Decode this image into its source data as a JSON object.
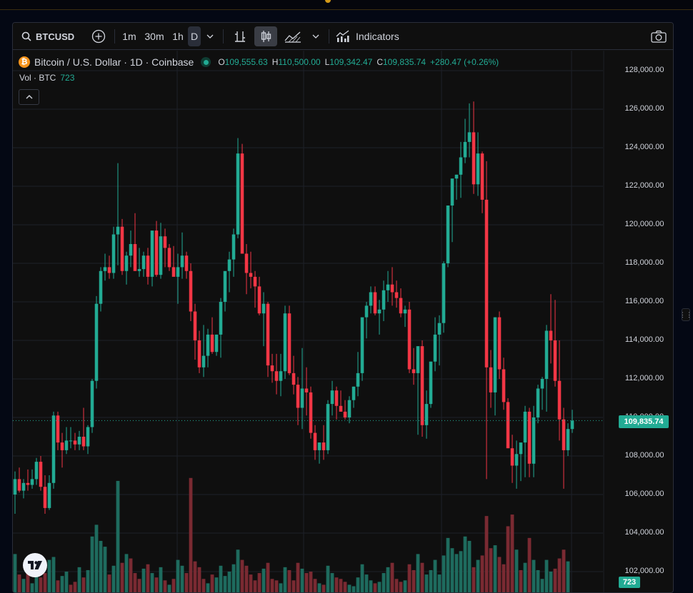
{
  "toolbar": {
    "symbol": "BTCUSD",
    "intervals": [
      "1m",
      "30m",
      "1h",
      "D"
    ],
    "indicators_label": "Indicators"
  },
  "legend": {
    "title": "Bitcoin / U.S. Dollar · 1D · Coinbase",
    "open_label": "O",
    "open": "109,555.63",
    "high_label": "H",
    "high": "110,500.00",
    "low_label": "L",
    "low": "109,342.47",
    "close_label": "C",
    "close": "109,835.74",
    "change": "+280.47 (+0.26%)"
  },
  "volume": {
    "label": "Vol · BTC",
    "value": "723"
  },
  "price_axis": [
    "128,000.00",
    "126,000.00",
    "124,000.00",
    "122,000.00",
    "120,000.00",
    "118,000.00",
    "116,000.00",
    "114,000.00",
    "112,000.00",
    "110,000.00",
    "108,000.00",
    "106,000.00",
    "104,000.00",
    "102,000.00"
  ],
  "last_price_badge": "109,835.74",
  "volume_badge": "723",
  "colors": {
    "up": "#22ab94",
    "down": "#f23645",
    "background": "#0f0f0f"
  },
  "chart_data": {
    "type": "candlestick",
    "ylim": [
      101500,
      129000
    ],
    "last_close": 109835.74,
    "candles": [
      [
        106000,
        107200,
        105000,
        106800
      ],
      [
        106800,
        107400,
        106100,
        106200
      ],
      [
        106200,
        106800,
        105800,
        106600
      ],
      [
        106600,
        107300,
        106200,
        106500
      ],
      [
        106500,
        107300,
        106300,
        106800
      ],
      [
        106800,
        107900,
        106500,
        107700
      ],
      [
        107700,
        108000,
        106200,
        106400
      ],
      [
        106400,
        107000,
        105000,
        105300
      ],
      [
        105300,
        107000,
        105200,
        106600
      ],
      [
        106600,
        110300,
        106300,
        110100
      ],
      [
        110100,
        110300,
        108300,
        108700
      ],
      [
        108700,
        109200,
        107400,
        108300
      ],
      [
        108300,
        109500,
        108100,
        108800
      ],
      [
        108800,
        109500,
        108400,
        108800
      ],
      [
        108800,
        109200,
        108300,
        108600
      ],
      [
        108600,
        109300,
        108300,
        109000
      ],
      [
        109000,
        110500,
        108300,
        108500
      ],
      [
        108500,
        109600,
        108100,
        109500
      ],
      [
        109500,
        112000,
        109200,
        111900
      ],
      [
        111900,
        116300,
        111500,
        115900
      ],
      [
        115900,
        117800,
        115500,
        117600
      ],
      [
        117600,
        118500,
        117100,
        117800
      ],
      [
        117800,
        118400,
        117200,
        117500
      ],
      [
        117500,
        119900,
        117200,
        119500
      ],
      [
        119500,
        123200,
        117900,
        119900
      ],
      [
        119900,
        120300,
        117400,
        117600
      ],
      [
        117600,
        118600,
        116900,
        118400
      ],
      [
        118400,
        119700,
        117800,
        119000
      ],
      [
        119000,
        120600,
        117900,
        117600
      ],
      [
        117600,
        118800,
        117300,
        117700
      ],
      [
        117700,
        118600,
        117300,
        118400
      ],
      [
        118400,
        118800,
        116900,
        117300
      ],
      [
        117300,
        119500,
        116800,
        119700
      ],
      [
        119700,
        120200,
        117300,
        117400
      ],
      [
        117400,
        120100,
        117200,
        119400
      ],
      [
        119400,
        119800,
        117800,
        118800
      ],
      [
        118800,
        119000,
        117600,
        117800
      ],
      [
        117800,
        118900,
        117400,
        117300
      ],
      [
        117300,
        118500,
        115900,
        117800
      ],
      [
        117800,
        119600,
        117200,
        118400
      ],
      [
        118400,
        118600,
        117200,
        117600
      ],
      [
        117600,
        118000,
        115000,
        115500
      ],
      [
        115500,
        115900,
        113000,
        114000
      ],
      [
        114000,
        114500,
        112300,
        112600
      ],
      [
        112600,
        114800,
        112100,
        113200
      ],
      [
        113200,
        114600,
        112600,
        114300
      ],
      [
        114300,
        115200,
        113300,
        113400
      ],
      [
        113400,
        114300,
        113200,
        114300
      ],
      [
        114300,
        116200,
        113100,
        116000
      ],
      [
        116000,
        117300,
        115500,
        117600
      ],
      [
        117600,
        118600,
        116500,
        118200
      ],
      [
        118200,
        119800,
        117300,
        119500
      ],
      [
        119500,
        124500,
        119300,
        123700
      ],
      [
        123700,
        124200,
        118800,
        118500
      ],
      [
        118500,
        119000,
        116400,
        117500
      ],
      [
        117500,
        118600,
        116700,
        117300
      ],
      [
        117300,
        117600,
        115700,
        116800
      ],
      [
        116800,
        117300,
        115300,
        115400
      ],
      [
        115400,
        116500,
        113700,
        115900
      ],
      [
        115900,
        116000,
        112100,
        112700
      ],
      [
        112700,
        113300,
        111800,
        112400
      ],
      [
        112400,
        113300,
        111200,
        111900
      ],
      [
        111900,
        113300,
        111100,
        112400
      ],
      [
        112400,
        115800,
        112000,
        115400
      ],
      [
        115400,
        115800,
        112200,
        112300
      ],
      [
        112300,
        113200,
        111200,
        111700
      ],
      [
        111700,
        112100,
        109600,
        110500
      ],
      [
        110500,
        113600,
        109400,
        111500
      ],
      [
        111500,
        112600,
        110100,
        111300
      ],
      [
        111300,
        111600,
        108900,
        109200
      ],
      [
        109200,
        109600,
        107800,
        108300
      ],
      [
        108300,
        108700,
        107600,
        108700
      ],
      [
        108700,
        109600,
        107800,
        108300
      ],
      [
        108300,
        110900,
        108100,
        110700
      ],
      [
        110700,
        111900,
        110100,
        111400
      ],
      [
        111400,
        111600,
        109900,
        110600
      ],
      [
        110600,
        111400,
        110300,
        110300
      ],
      [
        110300,
        110900,
        109900,
        110000
      ],
      [
        110000,
        111100,
        109700,
        110900
      ],
      [
        110900,
        111600,
        110500,
        111600
      ],
      [
        111600,
        113400,
        111100,
        112300
      ],
      [
        112300,
        114900,
        111900,
        115200
      ],
      [
        115200,
        116000,
        114100,
        115800
      ],
      [
        115800,
        116800,
        115400,
        116500
      ],
      [
        116500,
        116800,
        115300,
        115400
      ],
      [
        115400,
        116100,
        114300,
        115600
      ],
      [
        115600,
        117100,
        115000,
        116600
      ],
      [
        116600,
        117600,
        116000,
        116900
      ],
      [
        116900,
        117800,
        115800,
        116500
      ],
      [
        116500,
        117100,
        115700,
        116200
      ],
      [
        116200,
        116700,
        115200,
        115400
      ],
      [
        115400,
        115800,
        114700,
        115600
      ],
      [
        115600,
        116000,
        112300,
        112500
      ],
      [
        112500,
        113600,
        111700,
        112300
      ],
      [
        112300,
        113300,
        109100,
        113700
      ],
      [
        113700,
        114000,
        109000,
        109600
      ],
      [
        109600,
        111400,
        108900,
        110700
      ],
      [
        110700,
        112900,
        110500,
        112900
      ],
      [
        112900,
        115200,
        112400,
        114300
      ],
      [
        114300,
        115300,
        112700,
        114900
      ],
      [
        114900,
        118100,
        114400,
        118000
      ],
      [
        118000,
        120300,
        117800,
        121000
      ],
      [
        121000,
        122300,
        119100,
        122400
      ],
      [
        122400,
        122600,
        121300,
        122600
      ],
      [
        122600,
        124300,
        121400,
        123500
      ],
      [
        123500,
        125500,
        123200,
        124300
      ],
      [
        124300,
        126300,
        123500,
        124800
      ],
      [
        124800,
        126400,
        121600,
        122100
      ],
      [
        122100,
        124800,
        121500,
        123700
      ],
      [
        123700,
        123800,
        120600,
        121300
      ],
      [
        121300,
        123300,
        106800,
        112600
      ],
      [
        112600,
        113500,
        110500,
        111300
      ],
      [
        111300,
        115200,
        110100,
        115200
      ],
      [
        115200,
        115500,
        112000,
        112500
      ],
      [
        112500,
        113100,
        110400,
        110800
      ],
      [
        110800,
        111000,
        108800,
        108400
      ],
      [
        108400,
        109100,
        106600,
        107500
      ],
      [
        107500,
        108800,
        106300,
        108100
      ],
      [
        108100,
        108400,
        106700,
        108700
      ],
      [
        108700,
        110600,
        106900,
        110300
      ],
      [
        110300,
        110500,
        106900,
        107600
      ],
      [
        107600,
        110600,
        106900,
        110000
      ],
      [
        110000,
        111700,
        109700,
        111500
      ],
      [
        111500,
        112100,
        110400,
        112000
      ],
      [
        112000,
        114800,
        110300,
        114500
      ],
      [
        114500,
        116400,
        112800,
        114000
      ],
      [
        114000,
        116100,
        111600,
        111900
      ],
      [
        111900,
        114000,
        108800,
        109900
      ],
      [
        109900,
        110500,
        106300,
        108300
      ],
      [
        108300,
        109700,
        108000,
        109400
      ],
      [
        109400,
        110400,
        109200,
        109835
      ]
    ],
    "volumes": [
      [
        3.2,
        1
      ],
      [
        1.8,
        0
      ],
      [
        1.5,
        1
      ],
      [
        2.1,
        0
      ],
      [
        1.2,
        1
      ],
      [
        2.9,
        1
      ],
      [
        1.6,
        0
      ],
      [
        1.9,
        0
      ],
      [
        2.8,
        1
      ],
      [
        3.0,
        1
      ],
      [
        1.4,
        0
      ],
      [
        1.7,
        1
      ],
      [
        2.0,
        1
      ],
      [
        1.1,
        0
      ],
      [
        1.3,
        0
      ],
      [
        2.3,
        1
      ],
      [
        1.6,
        0
      ],
      [
        2.1,
        1
      ],
      [
        4.4,
        1
      ],
      [
        5.2,
        1
      ],
      [
        4.1,
        1
      ],
      [
        3.7,
        1
      ],
      [
        1.8,
        0
      ],
      [
        2.4,
        1
      ],
      [
        8.2,
        1
      ],
      [
        2.6,
        0
      ],
      [
        3.2,
        1
      ],
      [
        2.9,
        0
      ],
      [
        1.9,
        0
      ],
      [
        1.5,
        0
      ],
      [
        2.2,
        1
      ],
      [
        2.5,
        0
      ],
      [
        1.9,
        1
      ],
      [
        1.6,
        0
      ],
      [
        2.3,
        1
      ],
      [
        1.4,
        0
      ],
      [
        1.1,
        1
      ],
      [
        1.5,
        0
      ],
      [
        2.8,
        1
      ],
      [
        2.4,
        1
      ],
      [
        1.9,
        0
      ],
      [
        8.4,
        0
      ],
      [
        2.7,
        0
      ],
      [
        2.3,
        0
      ],
      [
        1.5,
        0
      ],
      [
        1.2,
        1
      ],
      [
        1.8,
        0
      ],
      [
        1.6,
        1
      ],
      [
        2.4,
        1
      ],
      [
        1.7,
        1
      ],
      [
        2.0,
        1
      ],
      [
        2.5,
        1
      ],
      [
        3.5,
        1
      ],
      [
        2.8,
        0
      ],
      [
        2.4,
        0
      ],
      [
        1.8,
        0
      ],
      [
        1.4,
        0
      ],
      [
        1.9,
        0
      ],
      [
        2.2,
        1
      ],
      [
        2.6,
        0
      ],
      [
        1.5,
        0
      ],
      [
        1.4,
        0
      ],
      [
        1.2,
        1
      ],
      [
        2.3,
        1
      ],
      [
        2.1,
        0
      ],
      [
        1.4,
        0
      ],
      [
        2.6,
        0
      ],
      [
        2.2,
        1
      ],
      [
        1.9,
        0
      ],
      [
        2.0,
        0
      ],
      [
        1.5,
        0
      ],
      [
        1.2,
        1
      ],
      [
        1.1,
        0
      ],
      [
        2.4,
        1
      ],
      [
        1.9,
        1
      ],
      [
        1.6,
        0
      ],
      [
        1.5,
        0
      ],
      [
        1.3,
        0
      ],
      [
        1.1,
        1
      ],
      [
        1.0,
        1
      ],
      [
        1.6,
        1
      ],
      [
        2.5,
        1
      ],
      [
        1.8,
        1
      ],
      [
        1.4,
        1
      ],
      [
        1.2,
        0
      ],
      [
        1.3,
        1
      ],
      [
        1.9,
        1
      ],
      [
        2.3,
        1
      ],
      [
        2.6,
        0
      ],
      [
        1.5,
        0
      ],
      [
        1.3,
        0
      ],
      [
        1.4,
        1
      ],
      [
        2.5,
        0
      ],
      [
        2.1,
        0
      ],
      [
        3.2,
        1
      ],
      [
        2.6,
        0
      ],
      [
        1.8,
        1
      ],
      [
        2.1,
        1
      ],
      [
        2.8,
        1
      ],
      [
        1.8,
        1
      ],
      [
        3.1,
        1
      ],
      [
        4.3,
        1
      ],
      [
        3.6,
        1
      ],
      [
        3.2,
        1
      ],
      [
        3.4,
        1
      ],
      [
        4.4,
        1
      ],
      [
        4.1,
        1
      ],
      [
        2.3,
        0
      ],
      [
        2.8,
        1
      ],
      [
        3.1,
        0
      ],
      [
        5.8,
        0
      ],
      [
        3.6,
        0
      ],
      [
        3.8,
        1
      ],
      [
        3.0,
        0
      ],
      [
        2.5,
        0
      ],
      [
        5.1,
        0
      ],
      [
        5.9,
        0
      ],
      [
        3.5,
        1
      ],
      [
        2.1,
        0
      ],
      [
        2.6,
        1
      ],
      [
        4.3,
        0
      ],
      [
        2.8,
        1
      ],
      [
        2.1,
        1
      ],
      [
        1.5,
        1
      ],
      [
        2.8,
        1
      ],
      [
        2.0,
        1
      ],
      [
        2.2,
        0
      ],
      [
        2.9,
        0
      ],
      [
        3.5,
        0
      ],
      [
        2.7,
        1
      ],
      [
        0.3,
        1
      ]
    ]
  }
}
